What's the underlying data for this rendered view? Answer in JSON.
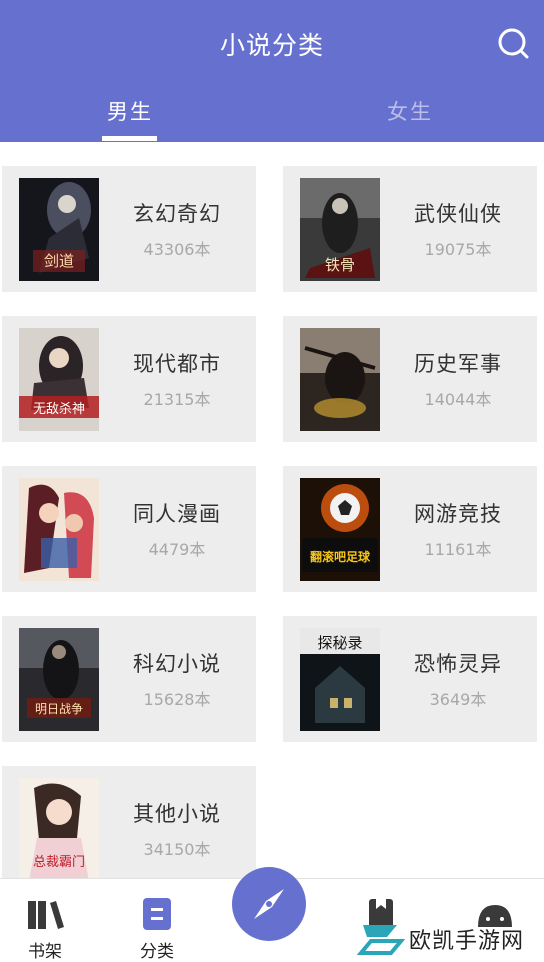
{
  "header": {
    "title": "小说分类",
    "search_icon": "search-icon"
  },
  "tabs": [
    {
      "label": "男生",
      "active": true
    },
    {
      "label": "女生",
      "active": false
    }
  ],
  "categories": [
    {
      "name": "玄幻奇幻",
      "count": "43306本",
      "cover_text": "剑道"
    },
    {
      "name": "武侠仙侠",
      "count": "19075本",
      "cover_text": "铁骨"
    },
    {
      "name": "现代都市",
      "count": "21315本",
      "cover_text": "无敌杀神"
    },
    {
      "name": "历史军事",
      "count": "14044本",
      "cover_text": ""
    },
    {
      "name": "同人漫画",
      "count": "4479本",
      "cover_text": ""
    },
    {
      "name": "网游竞技",
      "count": "11161本",
      "cover_text": "翻滚吧足球"
    },
    {
      "name": "科幻小说",
      "count": "15628本",
      "cover_text": "明日战争"
    },
    {
      "name": "恐怖灵异",
      "count": "3649本",
      "cover_text": "探秘录"
    },
    {
      "name": "其他小说",
      "count": "34150本",
      "cover_text": "总裁霸门"
    }
  ],
  "bottom_nav": [
    {
      "label": "书架",
      "icon": "bookshelf-icon"
    },
    {
      "label": "分类",
      "icon": "category-icon"
    },
    {
      "label": "",
      "icon": "compass-icon"
    },
    {
      "label": "",
      "icon": "bookmark-icon"
    },
    {
      "label": "",
      "icon": "profile-icon"
    }
  ],
  "watermark": {
    "text": "欧凯手游网",
    "icon": "ok-logo-icon"
  },
  "colors": {
    "accent": "#6670cf",
    "card_bg": "#ededed",
    "count_text": "#a8a8a8"
  }
}
